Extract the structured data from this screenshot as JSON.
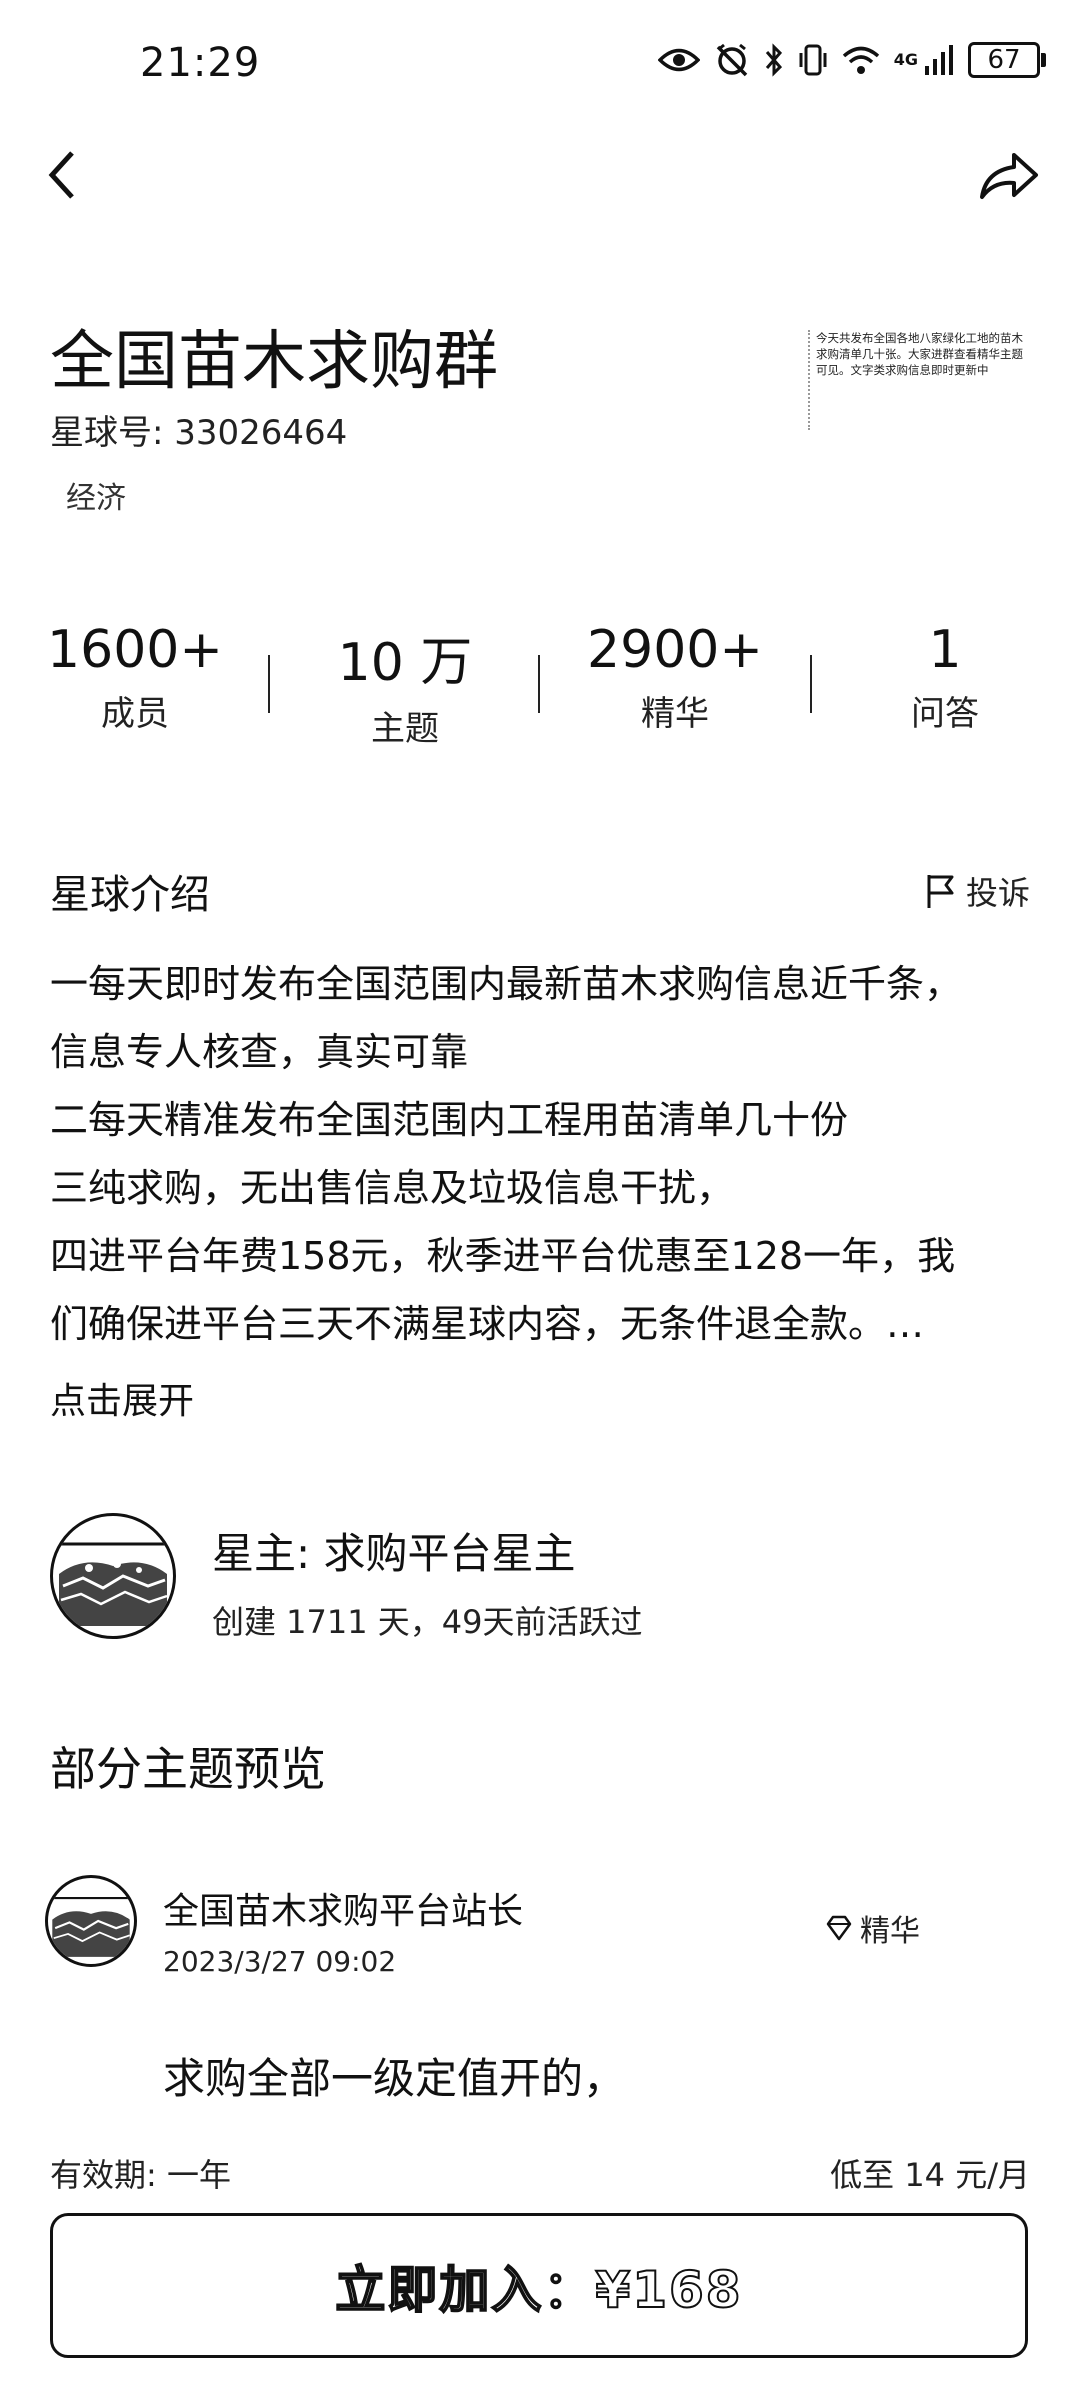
{
  "status_bar": {
    "time": "21:29",
    "network": "4G",
    "battery": "67",
    "icons": [
      "eye-icon",
      "alarm-off-icon",
      "bluetooth-icon",
      "vibrate-icon",
      "wifi-icon",
      "signal-icon",
      "battery-icon"
    ]
  },
  "nav": {
    "back_icon": "chevron-left-icon",
    "share_icon": "share-icon"
  },
  "group": {
    "title": "全国苗木求购群",
    "id_label": "星球号: 33026464",
    "tag": "经济",
    "cover_text": "今天共发布全国各地八家绿化工地的苗木求购清单几十张。大家进群查看精华主题可见。文字类求购信息即时更新中"
  },
  "stats": [
    {
      "value": "1600+",
      "label": "成员"
    },
    {
      "value": "10 万",
      "label": "主题"
    },
    {
      "value": "2900+",
      "label": "精华"
    },
    {
      "value": "1",
      "label": "问答"
    }
  ],
  "intro": {
    "heading": "星球介绍",
    "report_label": "投诉",
    "lines": [
      "一每天即时发布全国范围内最新苗木求购信息近千条，",
      "信息专人核查，真实可靠",
      "二每天精准发布全国范围内工程用苗清单几十份",
      "三纯求购，无出售信息及垃圾信息干扰，",
      "四进平台年费158元，秋季进平台优惠至128一年，我",
      "们确保进平台三天不满星球内容，无条件退全款。…"
    ],
    "expand_label": "点击展开"
  },
  "owner": {
    "name": "星主: 求购平台星主",
    "meta": "创建 1711 天，49天前活跃过"
  },
  "preview": {
    "heading": "部分主题预览",
    "post": {
      "author": "全国苗木求购平台站长",
      "date": "2023/3/27 09:02",
      "badge": "精华",
      "body": "求购全部一级定值开的，"
    }
  },
  "purchase": {
    "validity": "有效期: 一年",
    "monthly": "低至 14 元/月",
    "join_label": "立即加入：¥168"
  }
}
